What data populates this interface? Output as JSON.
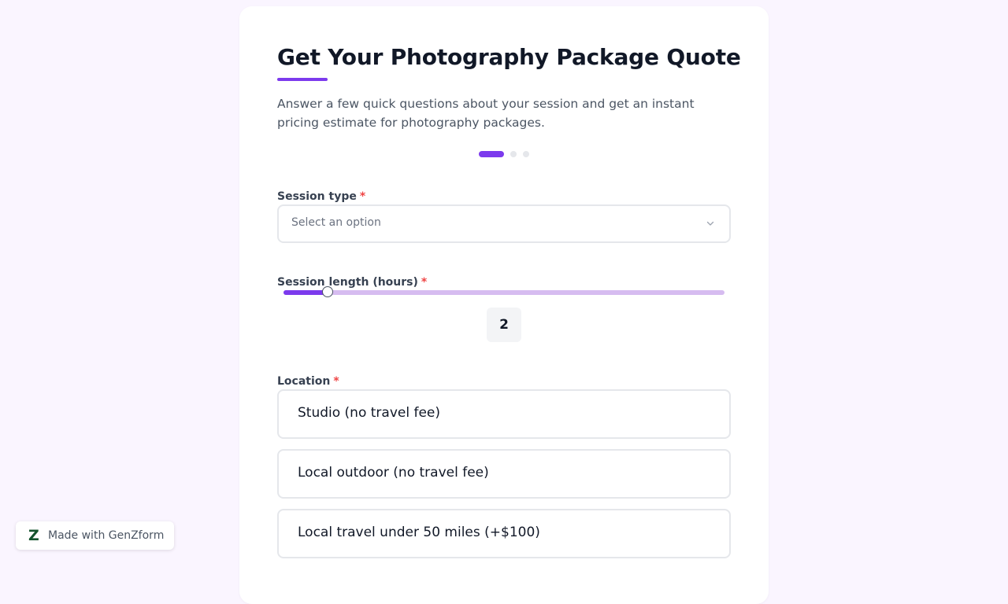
{
  "colors": {
    "accent": "#7c3aed",
    "track": "#d6bcf0",
    "required": "#ef4444",
    "brand_logo": "#14532d"
  },
  "form": {
    "title": "Get Your Photography Package Quote",
    "subtitle": "Answer a few quick questions about your session and get an instant pricing estimate for photography packages.",
    "progress": {
      "current_step": 1,
      "total_steps": 3
    },
    "session_type": {
      "label": "Session type",
      "required_mark": "*",
      "placeholder": "Select an option",
      "icon": "chevron-down-icon"
    },
    "session_length": {
      "label": "Session length (hours)",
      "required_mark": "*",
      "value": "2",
      "fraction": 0.1
    },
    "location": {
      "label": "Location",
      "required_mark": "*",
      "options": [
        "Studio (no travel fee)",
        "Local outdoor (no travel fee)",
        "Local travel under 50 miles (+$100)"
      ]
    }
  },
  "badge": {
    "logo": "Z",
    "text": "Made with GenZform"
  }
}
